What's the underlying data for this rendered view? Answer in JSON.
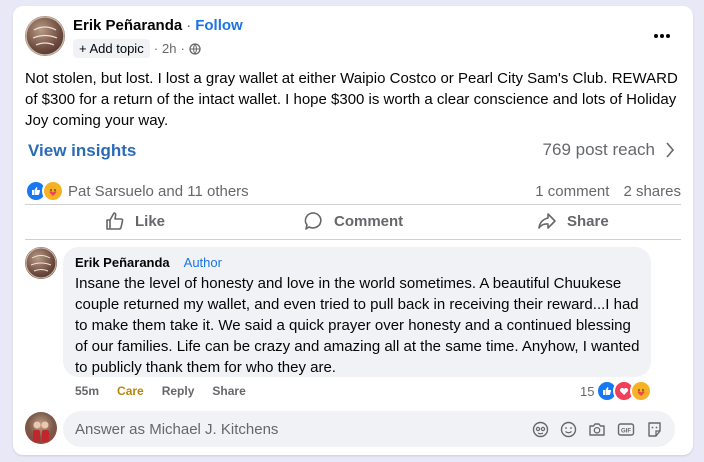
{
  "post": {
    "author_name": "Erik Peñaranda",
    "separator": "·",
    "follow_label": "Follow",
    "add_topic_label": "+ Add topic",
    "meta_separator": "·",
    "time": "2h",
    "text": "Not stolen, but lost. I lost a gray wallet at either Waipio Costco or Pearl City Sam's Club. REWARD of $300 for a return of the intact wallet. I hope $300 is worth a clear conscience and lots of Holiday Joy coming your way.",
    "insights_label": "View insights",
    "reach_label": "769 post reach",
    "reactions_text": "Pat Sarsuelo and 11 others",
    "comments_count": "1 comment",
    "shares_count": "2 shares"
  },
  "actions": {
    "like": "Like",
    "comment": "Comment",
    "share": "Share"
  },
  "comment": {
    "author_name": "Erik Peñaranda",
    "author_badge": "Author",
    "text": "Insane the level of honesty and love in the world sometimes. A beautiful Chuukese couple returned my wallet, and even tried to pull back in receiving their reward...I had to make them take it. We said a quick prayer over honesty and a continued blessing of our families. Life can be crazy and amazing all at the same time. Anyhow, I wanted to publicly thank them for who they are.",
    "time": "55m",
    "care_label": "Care",
    "reply_label": "Reply",
    "share_label": "Share",
    "reaction_count": "15"
  },
  "composer": {
    "placeholder": "Answer as Michael J. Kitchens"
  },
  "icons": {
    "globe": "globe-icon",
    "more": "more-options-icon",
    "chevron": "chevron-right-icon",
    "like": "thumbs-up-icon",
    "comment": "comment-bubble-icon",
    "share": "share-arrow-icon",
    "avatar_sticker": "avatar-sticker-icon",
    "emoji": "emoji-icon",
    "camera": "camera-icon",
    "gif": "gif-icon",
    "sticker": "sticker-icon"
  },
  "colors": {
    "accent": "#1b74e4",
    "care": "#b8860b",
    "background": "#e9e8f7"
  }
}
